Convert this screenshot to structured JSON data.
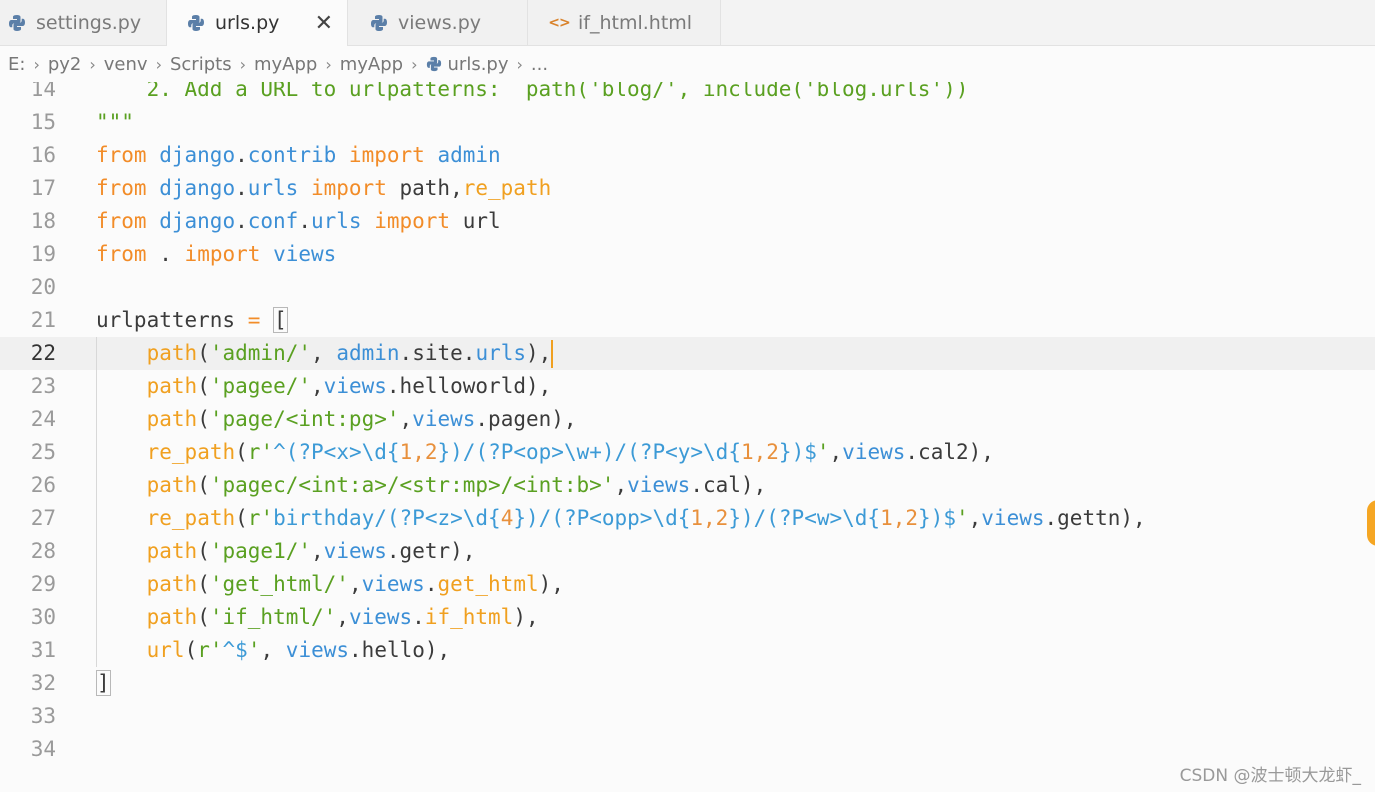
{
  "tabs": [
    {
      "label": "settings.py",
      "icon": "python-icon",
      "active": false
    },
    {
      "label": "urls.py",
      "icon": "python-icon",
      "active": true,
      "close": "✕"
    },
    {
      "label": "views.py",
      "icon": "python-icon",
      "active": false
    },
    {
      "label": "if_html.html",
      "icon": "html-icon",
      "active": false
    }
  ],
  "breadcrumb": [
    "E:",
    "py2",
    "venv",
    "Scripts",
    "myApp",
    "myApp",
    "urls.py",
    "..."
  ],
  "editor": {
    "current_line": "22",
    "lines": [
      {
        "n": "14",
        "text": "    2. Add a URL to urlpatterns:  path('blog/', include('blog.urls'))"
      },
      {
        "n": "15",
        "text": "\"\"\""
      },
      {
        "n": "16",
        "text": "from django.contrib import admin"
      },
      {
        "n": "17",
        "text": "from django.urls import path,re_path"
      },
      {
        "n": "18",
        "text": "from django.conf.urls import url"
      },
      {
        "n": "19",
        "text": "from . import views"
      },
      {
        "n": "20",
        "text": ""
      },
      {
        "n": "21",
        "text": "urlpatterns = ["
      },
      {
        "n": "22",
        "text": "    path('admin/', admin.site.urls),"
      },
      {
        "n": "23",
        "text": "    path('pagee/',views.helloworld),"
      },
      {
        "n": "24",
        "text": "    path('page/<int:pg>',views.pagen),"
      },
      {
        "n": "25",
        "text": "    re_path(r'^(?P<x>\\d{1,2})/(?P<op>\\w+)/(?P<y>\\d{1,2})$',views.cal2),"
      },
      {
        "n": "26",
        "text": "    path('pagec/<int:a>/<str:mp>/<int:b>',views.cal),"
      },
      {
        "n": "27",
        "text": "    re_path(r'birthday/(?P<z>\\d{4})/(?P<opp>\\d{1,2})/(?P<w>\\d{1,2})$',views.gettn),"
      },
      {
        "n": "28",
        "text": "    path('page1/',views.getr),"
      },
      {
        "n": "29",
        "text": "    path('get_html/',views.get_html),"
      },
      {
        "n": "30",
        "text": "    path('if_html/',views.if_html),"
      },
      {
        "n": "31",
        "text": "    url(r'^$', views.hello),"
      },
      {
        "n": "32",
        "text": "]"
      },
      {
        "n": "33",
        "text": ""
      },
      {
        "n": "34",
        "text": ""
      }
    ]
  },
  "watermark": "CSDN @波士顿大龙虾_",
  "colors": {
    "keyword": "#f28c28",
    "module": "#3c8fd6",
    "string": "#5aa021",
    "function": "#f0a020",
    "accent": "#f0a020"
  }
}
